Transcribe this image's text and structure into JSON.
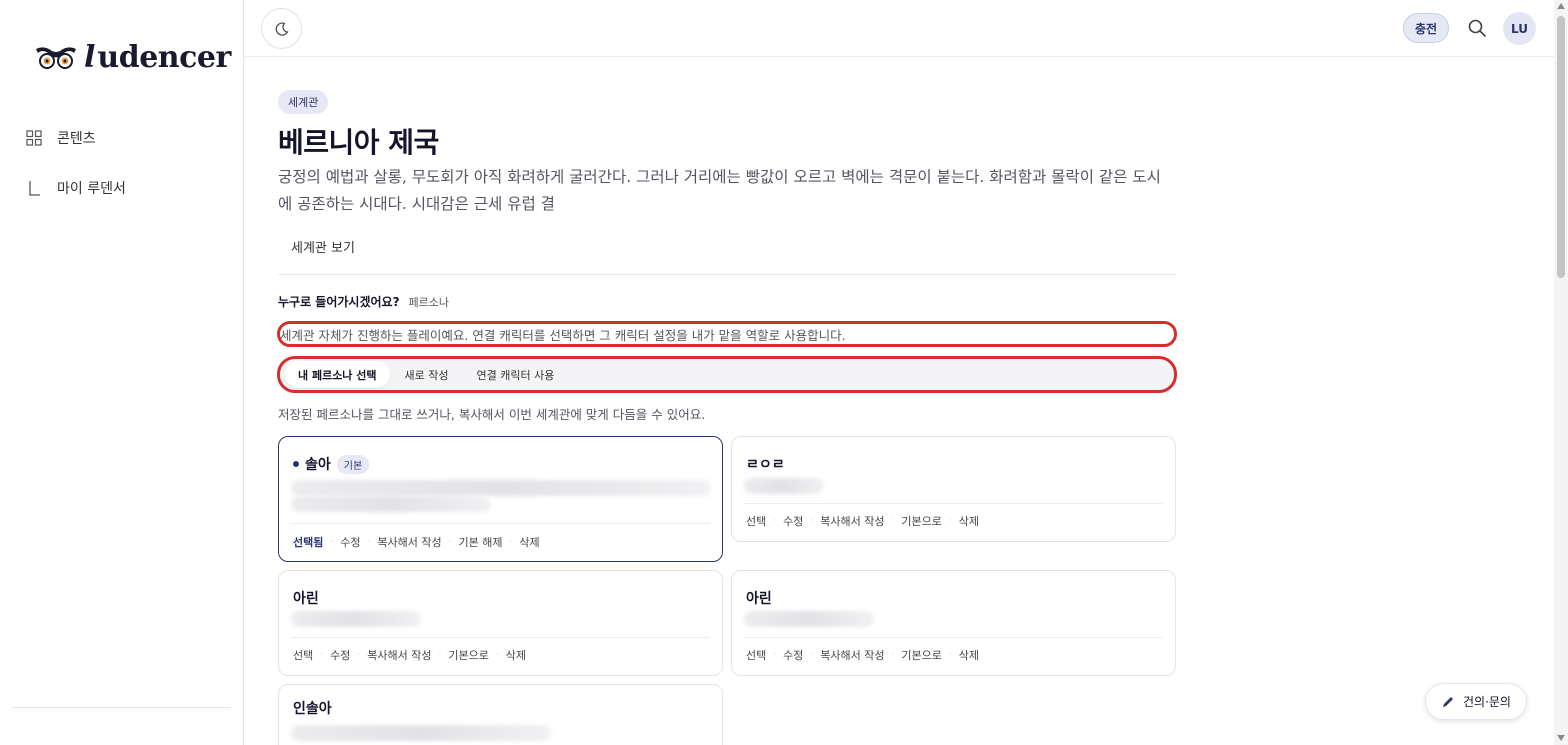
{
  "sidebar": {
    "logo_text": "udencer",
    "items": [
      {
        "label": "콘텐츠",
        "icon": "grid-icon"
      },
      {
        "label": "마이 루덴서",
        "icon": "corner-icon"
      }
    ]
  },
  "topbar": {
    "charge_label": "충전",
    "avatar_initials": "LU"
  },
  "main": {
    "tag": "세계관",
    "title": "베르니아 제국",
    "description": "궁정의 예법과 살롱, 무도회가 아직 화려하게 굴러간다. 그러나 거리에는 빵값이 오르고 벽에는 격문이 붙는다. 화려함과 몰락이 같은 도시에 공존하는 시대다. 시대감은 근세 유럽 결",
    "view_button": "세계관 보기",
    "question_label": "누구로 들어가시겠어요?",
    "question_sub": "페르소나",
    "info_text": "세계관 자체가 진행하는 플레이예요. 연결 캐릭터를 선택하면 그 캐릭터 설정을 내가 맡을 역할로 사용합니다.",
    "tabs": [
      "내 페르소나 선택",
      "새로 작성",
      "연결 캐릭터 사용"
    ],
    "hint": "저장된 페르소나를 그대로 쓰거나, 복사해서 이번 세계관에 맞게 다듬을 수 있어요."
  },
  "cards": [
    {
      "name": "솔아",
      "badge": "기본",
      "actions": [
        "선택됨",
        "수정",
        "복사해서 작성",
        "기본 해제",
        "삭제"
      ]
    },
    {
      "name": "ㄹㅇㄹ",
      "actions": [
        "선택",
        "수정",
        "복사해서 작성",
        "기본으로",
        "삭제"
      ]
    },
    {
      "name": "아린",
      "actions": [
        "선택",
        "수정",
        "복사해서 작성",
        "기본으로",
        "삭제"
      ]
    },
    {
      "name": "아린",
      "actions": [
        "선택",
        "수정",
        "복사해서 작성",
        "기본으로",
        "삭제"
      ]
    },
    {
      "name": "인솔아"
    }
  ],
  "feedback_label": "건의·문의",
  "colors": {
    "accent": "#2a3570",
    "highlight": "#d32f2f",
    "tag_bg": "#e6e9f5"
  }
}
